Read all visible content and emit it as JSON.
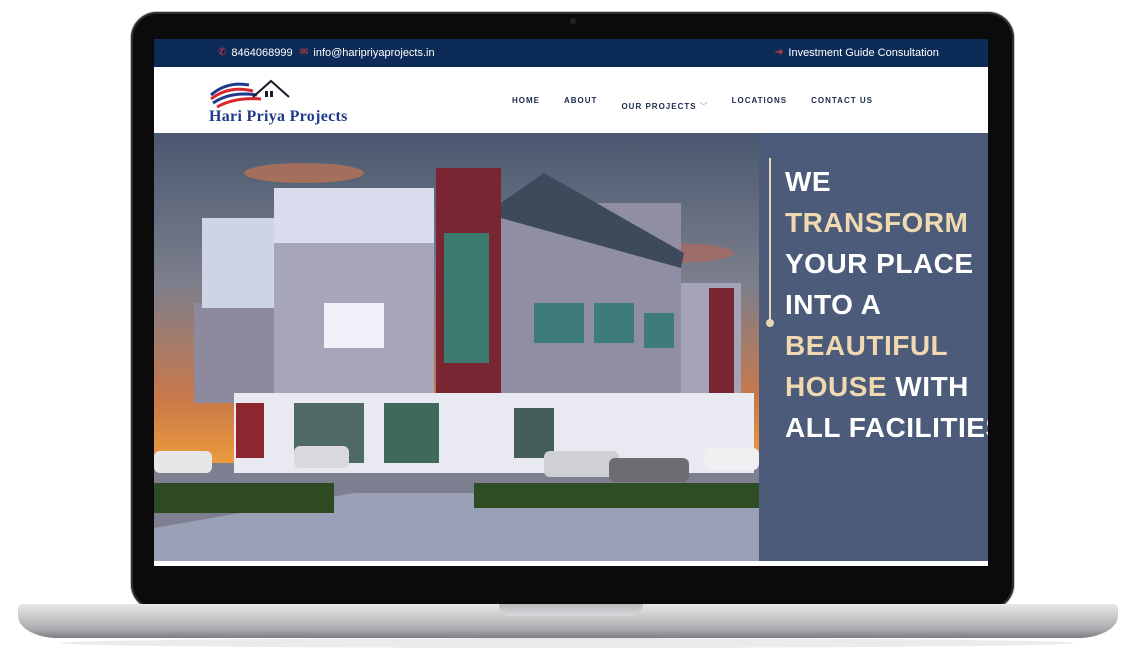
{
  "topbar": {
    "phone": "8464068999",
    "email": "info@haripriyaprojects.in",
    "cta": "Investment Guide Consultation",
    "phone_icon": "phone-icon",
    "email_icon": "envelope-icon",
    "cta_icon": "arrow-right-icon"
  },
  "logo": {
    "text": "Hari Priya Projects"
  },
  "nav": {
    "items": [
      "HOME",
      "ABOUT",
      "OUR PROJECTS",
      "LOCATIONS",
      "CONTACT US"
    ],
    "dropdown_icon": "chevron-down-icon"
  },
  "hero": {
    "lines": [
      {
        "text": "WE",
        "color": "#ffffff"
      },
      {
        "text": "TRANSFORM",
        "color": "#f0d9b0"
      },
      {
        "text": "YOUR PLACE",
        "color": "#ffffff"
      },
      {
        "text": "INTO A",
        "color": "#ffffff"
      },
      {
        "text": "BEAUTIFUL",
        "color": "#f0d9b0"
      },
      {
        "text": "HOUSE",
        "color": "#f0d9b0",
        "rest": "WITH"
      },
      {
        "text": "ALL FACILITIES",
        "color": "#ffffff"
      }
    ]
  },
  "colors": {
    "topbar": "#0c2c57",
    "accent_red": "#e23b3b",
    "panel": "#4b5b79",
    "gold": "#f0d9b0"
  }
}
